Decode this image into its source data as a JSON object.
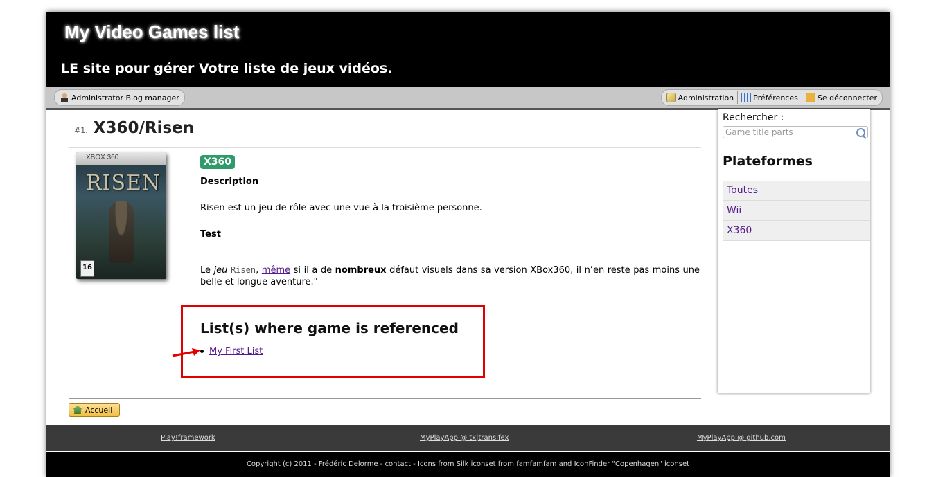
{
  "header": {
    "title": "My Video Games list",
    "subtitle": "LE site pour gérer Votre liste de jeux vidéos."
  },
  "userbar": {
    "user_label": "Administrator Blog manager",
    "administration": "Administration",
    "preferences": "Préférences",
    "logout": "Se déconnecter"
  },
  "game": {
    "number": "#1.",
    "title": "X360/Risen",
    "platform_badge": "X360",
    "cover": {
      "band_text": "XBOX 360",
      "logo_text": "RISEN",
      "rating": "16"
    },
    "description_heading": "Description",
    "description_text": "Risen est un jeu de rôle avec une vue à la troisième personne.",
    "test_heading": "Test",
    "test_text": {
      "part1": "Le ",
      "em": "jeu",
      "part2": " ",
      "code": "Risen",
      "part3": ", ",
      "link": "même",
      "part4": " si il a de ",
      "strong": "nombreux",
      "part5": " défaut visuels dans sa version XBox360, il n’en reste pas moins une belle et longue aventure.\""
    }
  },
  "references": {
    "heading": "List(s) where game is referenced",
    "items": [
      "My First List"
    ]
  },
  "home_button": "Accueil",
  "sidebar": {
    "search_label": "Rechercher :",
    "search_placeholder": "Game title parts",
    "platforms_heading": "Plateformes",
    "platforms": [
      "Toutes",
      "Wii",
      "X360"
    ]
  },
  "footer": {
    "links": [
      "Play!framework",
      "MyPlayApp @ tx|transifex",
      "MyPlayApp @ github.com"
    ],
    "copyright": {
      "prefix": "Copyright (c) 2011 - Frédéric Delorme - ",
      "contact": "contact",
      "mid": " - Icons from ",
      "silk": "Silk iconset from famfamfam",
      "and": " and ",
      "iconfinder": "IconFinder \"Copenhagen\" iconset"
    }
  },
  "colors": {
    "badge": "#2f9a6a",
    "highlight_box": "#e00000",
    "link": "#551a8b"
  }
}
